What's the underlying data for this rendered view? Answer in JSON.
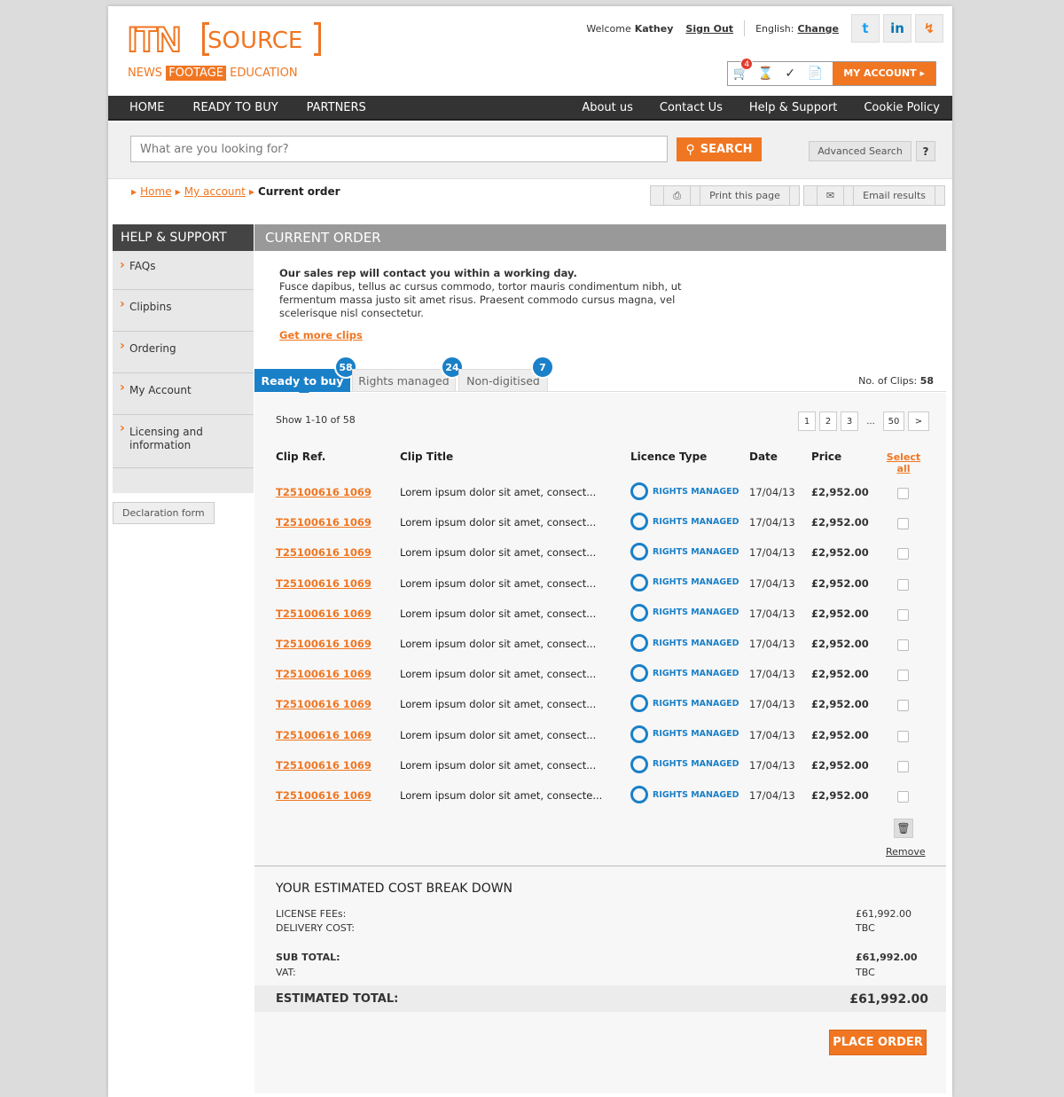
{
  "header": {
    "logo_main": "ITN",
    "logo_source": "SOURCE",
    "tag_news": "NEWS",
    "tag_footage": "FOOTAGE",
    "tag_education": "EDUCATION",
    "welcome": "Welcome",
    "user": "Kathey",
    "sign_out": "Sign Out",
    "language": "English:",
    "change": "Change",
    "cart_count": "4",
    "my_account": "MY ACCOUNT ▸"
  },
  "nav": {
    "left": [
      "HOME",
      "READY TO BUY",
      "PARTNERS"
    ],
    "right": [
      "About us",
      "Contact Us",
      "Help & Support",
      "Cookie Policy"
    ]
  },
  "search": {
    "placeholder": "What are you looking for?",
    "button": "SEARCH",
    "advanced": "Advanced Search",
    "help": "?"
  },
  "breadcrumb": {
    "home": "Home",
    "account": "My account",
    "current": "Current order"
  },
  "tools": {
    "print": "Print this page",
    "email": "Email results"
  },
  "sidebar": {
    "title": "HELP & SUPPORT",
    "items": [
      "FAQs",
      "Clipbins",
      "Ordering",
      "My Account",
      "Licensing and information"
    ],
    "declaration": "Declaration form"
  },
  "main": {
    "title": "CURRENT ORDER",
    "intro_bold": "Our sales rep will contact you within a working day.",
    "intro_text": "Fusce dapibus, tellus ac cursus commodo, tortor mauris condimentum nibh, ut fermentum massa justo sit amet risus. Praesent commodo cursus magna, vel scelerisque nisl consectetur.",
    "more_link": "Get more clips",
    "tabs": [
      {
        "label": "Ready to buy",
        "count": "58"
      },
      {
        "label": "Rights managed",
        "count": "24"
      },
      {
        "label": "Non-digitised",
        "count": "7"
      }
    ],
    "clips_label": "No. of Clips:",
    "clips_value": "58",
    "show": "Show 1-10 of 58",
    "pager": [
      "1",
      "2",
      "3",
      "...",
      "50",
      ">"
    ],
    "columns": {
      "ref": "Clip Ref.",
      "title": "Clip Title",
      "licence": "Licence Type",
      "date": "Date",
      "price": "Price",
      "select_all": "Select all"
    },
    "rows": [
      {
        "ref": "T25100616 1069",
        "title": "Lorem ipsum dolor sit amet, consect...",
        "licence": "RIGHTS MANAGED",
        "date": "17/04/13",
        "price": "£2,952.00"
      },
      {
        "ref": "T25100616 1069",
        "title": "Lorem ipsum dolor sit amet, consect...",
        "licence": "RIGHTS MANAGED",
        "date": "17/04/13",
        "price": "£2,952.00"
      },
      {
        "ref": "T25100616 1069",
        "title": "Lorem ipsum dolor sit amet, consect...",
        "licence": "RIGHTS MANAGED",
        "date": "17/04/13",
        "price": "£2,952.00"
      },
      {
        "ref": "T25100616 1069",
        "title": "Lorem ipsum dolor sit amet, consect...",
        "licence": "RIGHTS MANAGED",
        "date": "17/04/13",
        "price": "£2,952.00"
      },
      {
        "ref": "T25100616 1069",
        "title": "Lorem ipsum dolor sit amet, consect...",
        "licence": "RIGHTS MANAGED",
        "date": "17/04/13",
        "price": "£2,952.00"
      },
      {
        "ref": "T25100616 1069",
        "title": "Lorem ipsum dolor sit amet, consect...",
        "licence": "RIGHTS MANAGED",
        "date": "17/04/13",
        "price": "£2,952.00"
      },
      {
        "ref": "T25100616 1069",
        "title": "Lorem ipsum dolor sit amet, consect...",
        "licence": "RIGHTS MANAGED",
        "date": "17/04/13",
        "price": "£2,952.00"
      },
      {
        "ref": "T25100616 1069",
        "title": "Lorem ipsum dolor sit amet, consect...",
        "licence": "RIGHTS MANAGED",
        "date": "17/04/13",
        "price": "£2,952.00"
      },
      {
        "ref": "T25100616 1069",
        "title": "Lorem ipsum dolor sit amet, consect...",
        "licence": "RIGHTS MANAGED",
        "date": "17/04/13",
        "price": "£2,952.00"
      },
      {
        "ref": "T25100616 1069",
        "title": "Lorem ipsum dolor sit amet, consect...",
        "licence": "RIGHTS MANAGED",
        "date": "17/04/13",
        "price": "£2,952.00"
      },
      {
        "ref": "T25100616 1069",
        "title": "Lorem ipsum dolor sit amet, consecte...",
        "licence": "RIGHTS MANAGED",
        "date": "17/04/13",
        "price": "£2,952.00"
      }
    ],
    "remove": "Remove"
  },
  "cost": {
    "title": "YOUR ESTIMATED COST BREAK DOWN",
    "license_label": "LICENSE FEEs:",
    "license_value": "£61,992.00",
    "delivery_label": "DELIVERY COST:",
    "delivery_value": "TBC",
    "subtotal_label": "SUB TOTAL:",
    "subtotal_value": "£61,992.00",
    "vat_label": "VAT:",
    "vat_value": "TBC",
    "total_label": "ESTIMATED TOTAL:",
    "total_value": "£61,992.00",
    "place_order": "PLACE ORDER"
  },
  "colors": {
    "accent": "#f07622",
    "blue": "#1a80c8",
    "nav": "#333333"
  }
}
